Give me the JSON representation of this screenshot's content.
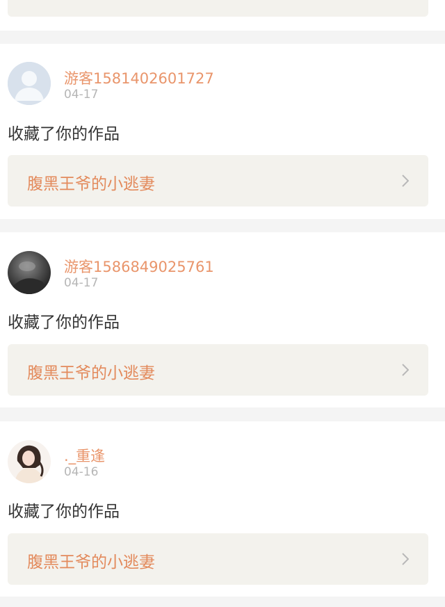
{
  "feed": [
    {
      "avatar_icon": "default-user-avatar-icon",
      "username": "游客1581402601727",
      "date": "04-17",
      "action": "收藏了你的作品",
      "work_title": "腹黑王爷的小逃妻"
    },
    {
      "avatar_icon": "dark-photo-avatar-icon",
      "username": "游客1586849025761",
      "date": "04-17",
      "action": "收藏了你的作品",
      "work_title": "腹黑王爷的小逃妻"
    },
    {
      "avatar_icon": "girl-photo-avatar-icon",
      "username": "._重逢",
      "date": "04-16",
      "action": "收藏了你的作品",
      "work_title": "腹黑王爷的小逃妻"
    }
  ],
  "colors": {
    "username": "#e9956b",
    "work_title": "#e38a5c",
    "work_bg": "#f3f2ed",
    "page_bg": "#f4f4f4"
  }
}
